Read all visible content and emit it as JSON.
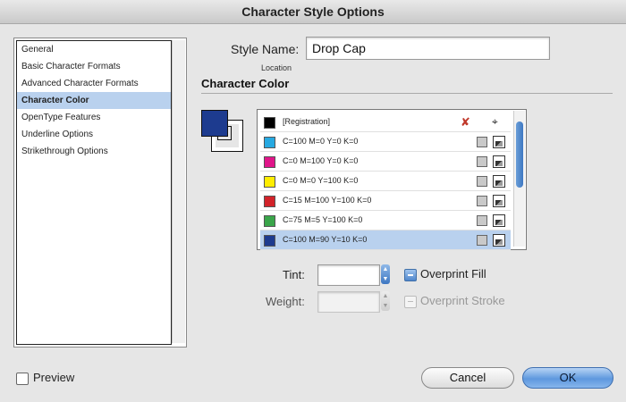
{
  "window": {
    "title": "Character Style Options"
  },
  "sidebar": {
    "items": [
      {
        "label": "General",
        "selected": false
      },
      {
        "label": "Basic Character Formats",
        "selected": false
      },
      {
        "label": "Advanced Character Formats",
        "selected": false
      },
      {
        "label": "Character Color",
        "selected": true
      },
      {
        "label": "OpenType Features",
        "selected": false
      },
      {
        "label": "Underline Options",
        "selected": false
      },
      {
        "label": "Strikethrough Options",
        "selected": false
      }
    ]
  },
  "style_name": {
    "label": "Style Name:",
    "value": "Drop Cap"
  },
  "location": {
    "label": "Location"
  },
  "section": {
    "title": "Character Color"
  },
  "swatches": [
    {
      "name": "[Registration]",
      "color": "#000000"
    },
    {
      "name": "C=100 M=0 Y=0 K=0",
      "color": "#27a9e1"
    },
    {
      "name": "C=0 M=100 Y=0 K=0",
      "color": "#e0168a"
    },
    {
      "name": "C=0 M=0 Y=100 K=0",
      "color": "#ffed00"
    },
    {
      "name": "C=15 M=100 Y=100 K=0",
      "color": "#d2232a"
    },
    {
      "name": "C=75 M=5 Y=100 K=0",
      "color": "#3aa54a"
    },
    {
      "name": "C=100 M=90 Y=10 K=0",
      "color": "#1d3b8f"
    }
  ],
  "selected_swatch_index": 6,
  "tint": {
    "label": "Tint:",
    "value": ""
  },
  "weight": {
    "label": "Weight:",
    "value": ""
  },
  "overprint_fill": {
    "label": "Overprint Fill"
  },
  "overprint_stroke": {
    "label": "Overprint Stroke"
  },
  "preview": {
    "label": "Preview"
  },
  "buttons": {
    "cancel": "Cancel",
    "ok": "OK"
  },
  "icons": {
    "swatch_none": "x-icon",
    "swatch_target": "target-icon",
    "process_gray": "square-gray-icon",
    "process_cmyk": "cmyk-icon"
  }
}
